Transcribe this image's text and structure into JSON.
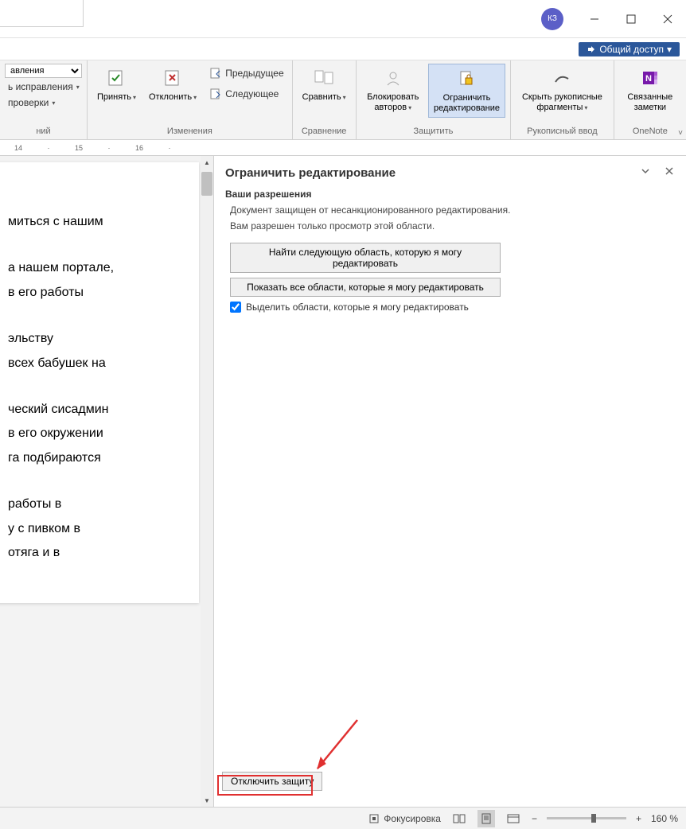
{
  "titlebar": {
    "user_initials": "КЗ"
  },
  "share": {
    "label": "Общий доступ"
  },
  "ribbon": {
    "left": {
      "dropdown1": "авления",
      "item1": "ь исправления",
      "item2": "проверки",
      "item3": "ний"
    },
    "changes": {
      "accept": "Принять",
      "reject": "Отклонить",
      "previous": "Предыдущее",
      "next": "Следующее",
      "label": "Изменения"
    },
    "compare": {
      "button": "Сравнить",
      "label": "Сравнение"
    },
    "protect": {
      "block": "Блокировать авторов",
      "restrict": "Ограничить редактирование",
      "label": "Защитить"
    },
    "ink": {
      "hide": "Скрыть рукописные фрагменты",
      "label": "Рукописный ввод"
    },
    "onenote": {
      "button": "Связанные заметки",
      "label": "OneNote"
    }
  },
  "ruler": {
    "marks": [
      "14",
      "",
      "15",
      "",
      "16",
      ""
    ]
  },
  "document": {
    "p1": "миться с нашим",
    "p2a": "а нашем портале,",
    "p2b": "в его работы",
    "p3a": "эльству",
    "p3b": "всех бабушек на",
    "p4a": "ческий сисадмин",
    "p4b": "в его окружении",
    "p4c": "га подбираются",
    "p5a": "работы в",
    "p5b": "у с пивком в",
    "p5c": "отяга и в"
  },
  "pane": {
    "title": "Ограничить редактирование",
    "section": "Ваши разрешения",
    "line1": "Документ защищен от несанкционированного редактирования.",
    "line2": "Вам разрешен только просмотр этой области.",
    "btn_find": "Найти следующую область, которую я могу редактировать",
    "btn_show": "Показать все области, которые я могу редактировать",
    "check": "Выделить области, которые я могу редактировать",
    "stop": "Отключить защиту"
  },
  "statusbar": {
    "focus": "Фокусировка",
    "zoom": "160 %"
  }
}
